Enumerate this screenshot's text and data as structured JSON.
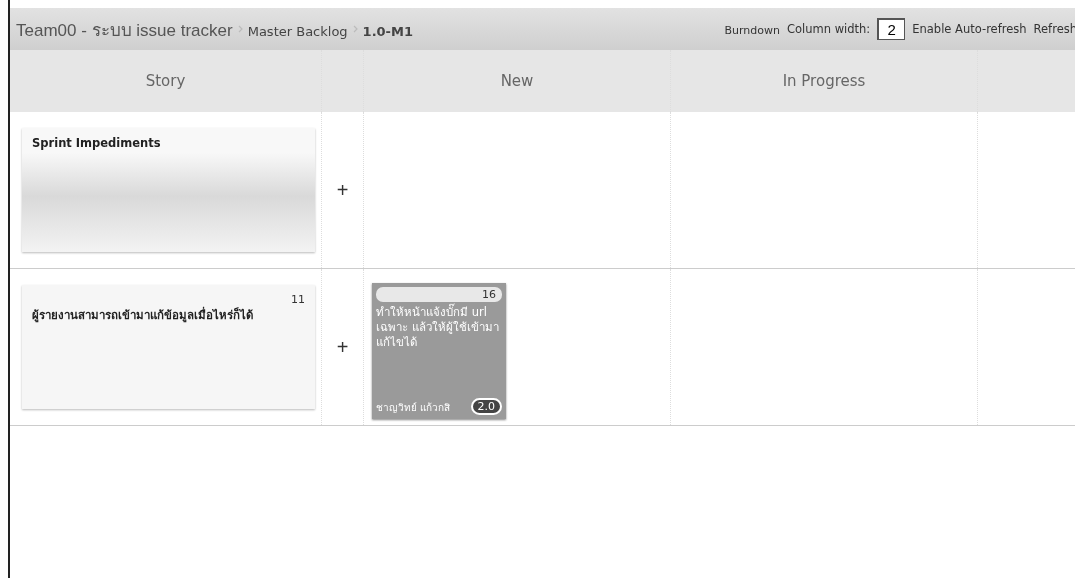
{
  "breadcrumb": [
    {
      "label": "Team00 - ระบบ issue tracker",
      "kind": "project"
    },
    {
      "label": "Master Backlog",
      "kind": "link"
    },
    {
      "label": "1.0-M1",
      "kind": "current"
    }
  ],
  "toolbar": {
    "burndown": "Burndown",
    "column_width_label": "Column width:",
    "column_width_value": "2",
    "auto_refresh": "Enable Auto-refresh",
    "refresh": "Refresh"
  },
  "columns": [
    "Story",
    "New",
    "In Progress"
  ],
  "rows": [
    {
      "story": {
        "title": "Sprint Impediments",
        "kind": "impediments"
      },
      "add": "+",
      "new_tasks": []
    },
    {
      "story": {
        "title": "ผู้รายงานสามารถเข้ามาแก้ข้อมูลเมื่อไหร่ก็ได้",
        "id": "11",
        "kind": "story"
      },
      "add": "+",
      "new_tasks": [
        {
          "id": "16",
          "text": "ทำให้หน้าแจ้งบั๊กมี url เฉพาะ แล้วให้ผู้ใช้เข้ามาแก้ไขได้",
          "assignee": "ชาญวิทย์ แก้วกสิ",
          "estimate": "2.0"
        }
      ]
    }
  ]
}
